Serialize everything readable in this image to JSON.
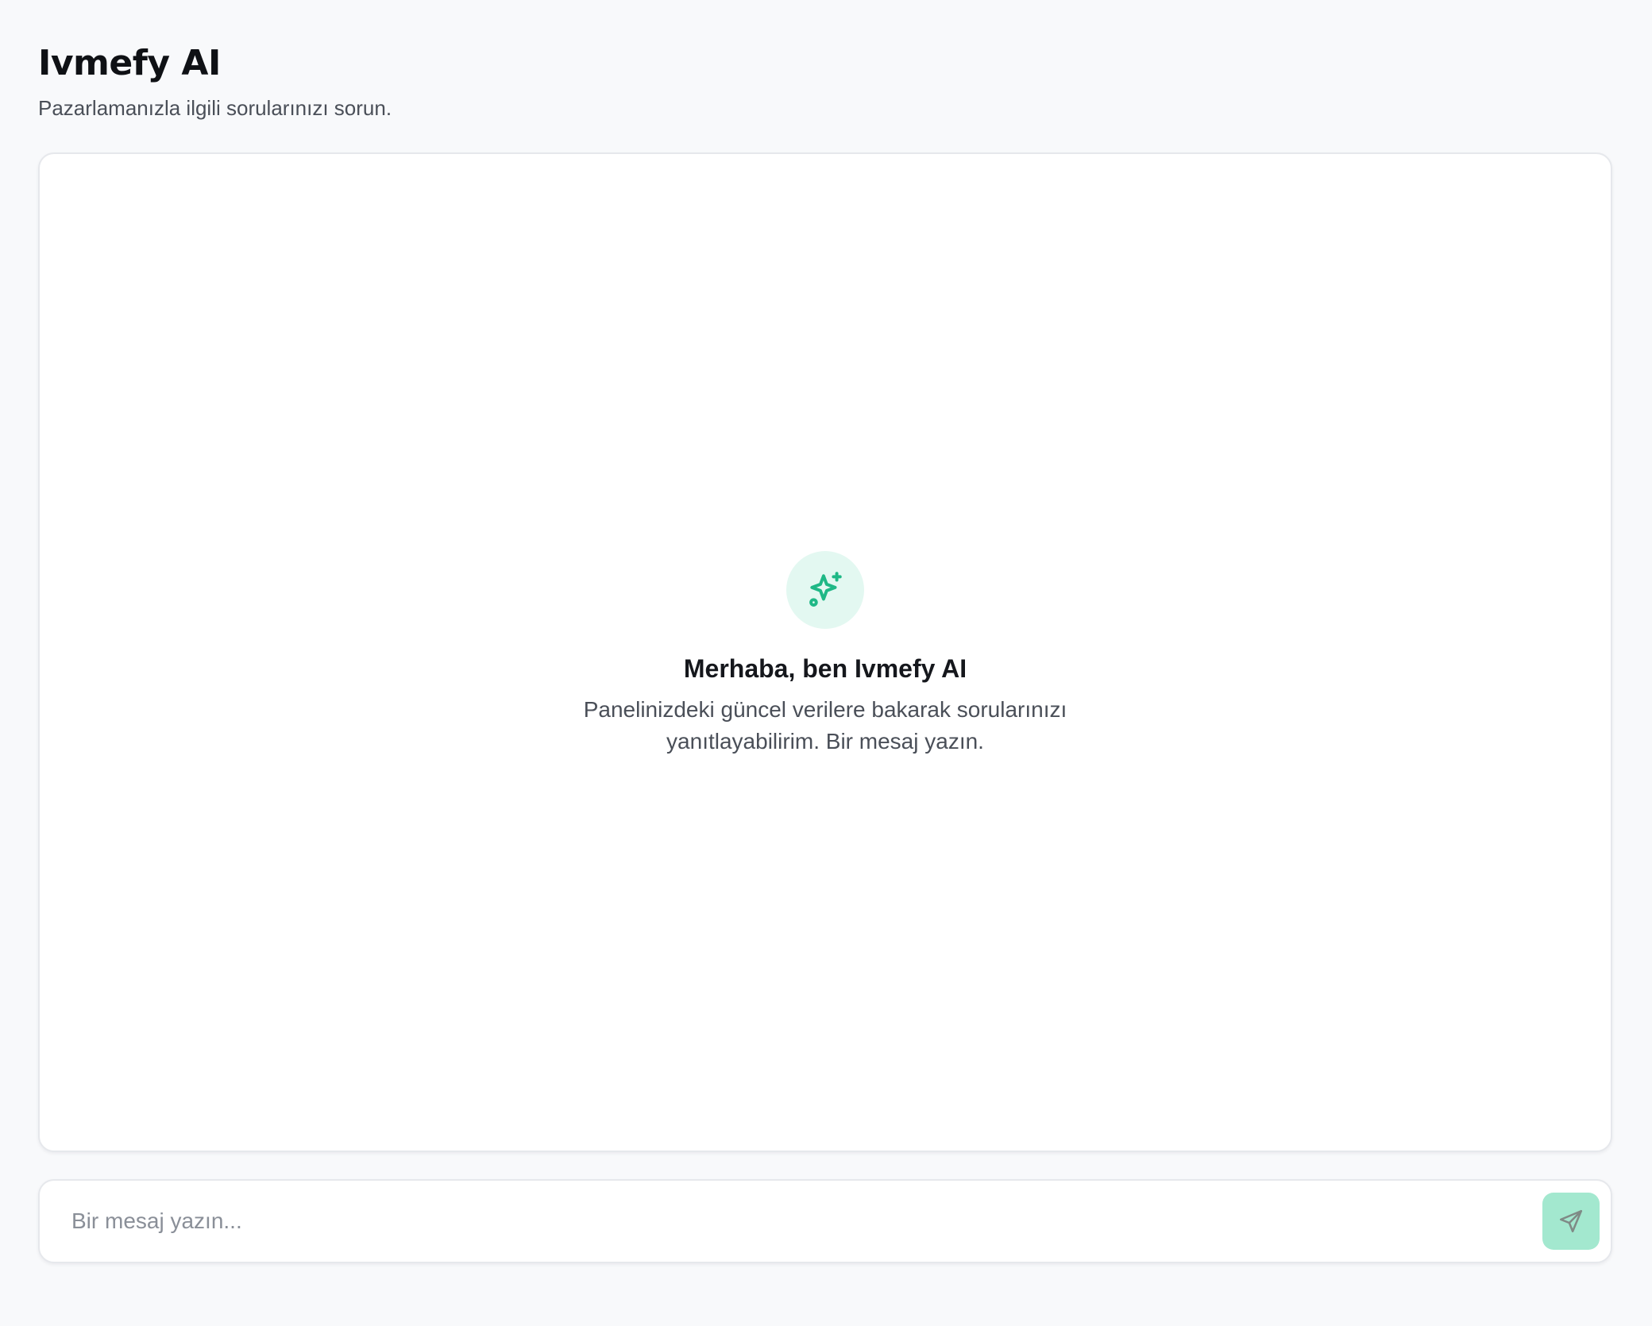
{
  "header": {
    "title": "Ivmefy AI",
    "subtitle": "Pazarlamanızla ilgili sorularınızı sorun."
  },
  "empty_state": {
    "icon": "sparkles-icon",
    "title": "Merhaba, ben Ivmefy AI",
    "description": "Panelinizdeki güncel verilere bakarak sorularınızı yanıtlayabilirim. Bir mesaj yazın."
  },
  "composer": {
    "placeholder": "Bir mesaj yazın...",
    "value": "",
    "send_icon": "send-icon"
  },
  "colors": {
    "accent": "#1fb886",
    "accent_soft": "#e3f8f1",
    "send_button_disabled": "#a3e8cf",
    "background": "#f8f9fb",
    "panel": "#ffffff"
  }
}
